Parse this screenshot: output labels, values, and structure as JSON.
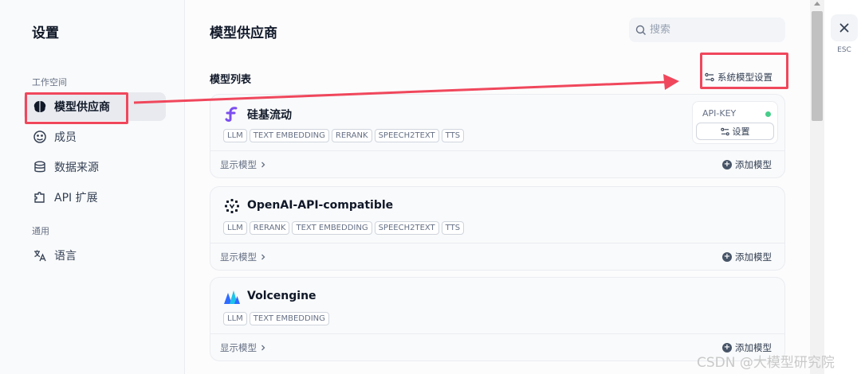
{
  "sidebar": {
    "title": "设置",
    "sections": [
      {
        "label": "工作空间"
      },
      {
        "label": "通用"
      }
    ],
    "items": [
      {
        "label": "模型供应商",
        "icon": "brain-icon",
        "active": true
      },
      {
        "label": "成员",
        "icon": "members-icon"
      },
      {
        "label": "数据来源",
        "icon": "database-icon"
      },
      {
        "label": "API 扩展",
        "icon": "puzzle-icon"
      },
      {
        "label": "语言",
        "icon": "translate-icon"
      }
    ]
  },
  "main": {
    "title": "模型供应商",
    "search": {
      "placeholder": "搜索"
    },
    "list_title": "模型列表",
    "system_settings_label": "系统模型设置",
    "providers": [
      {
        "name": "硅基流动",
        "icon": "siliconflow-logo-icon",
        "tags": [
          "LLM",
          "TEXT EMBEDDING",
          "RERANK",
          "SPEECH2TEXT",
          "TTS"
        ],
        "api_key_label": "API-KEY",
        "settings_label": "设置",
        "show_models": "显示模型",
        "add_model": "添加模型"
      },
      {
        "name": "OpenAI-API-compatible",
        "icon": "openai-compatible-logo-icon",
        "tags": [
          "LLM",
          "RERANK",
          "TEXT EMBEDDING",
          "SPEECH2TEXT",
          "TTS"
        ],
        "show_models": "显示模型",
        "add_model": "添加模型"
      },
      {
        "name": "Volcengine",
        "icon": "volcengine-logo-icon",
        "tags": [
          "LLM",
          "TEXT EMBEDDING"
        ],
        "show_models": "显示模型",
        "add_model": "添加模型"
      }
    ]
  },
  "close": {
    "esc_label": "ESC"
  },
  "watermark": "CSDN @大模型研究院",
  "colors": {
    "highlight": "#f0475c",
    "status_ok": "#47cd89",
    "siliconflow": "#7b4ef0",
    "volcengine": "#2f6bff"
  }
}
